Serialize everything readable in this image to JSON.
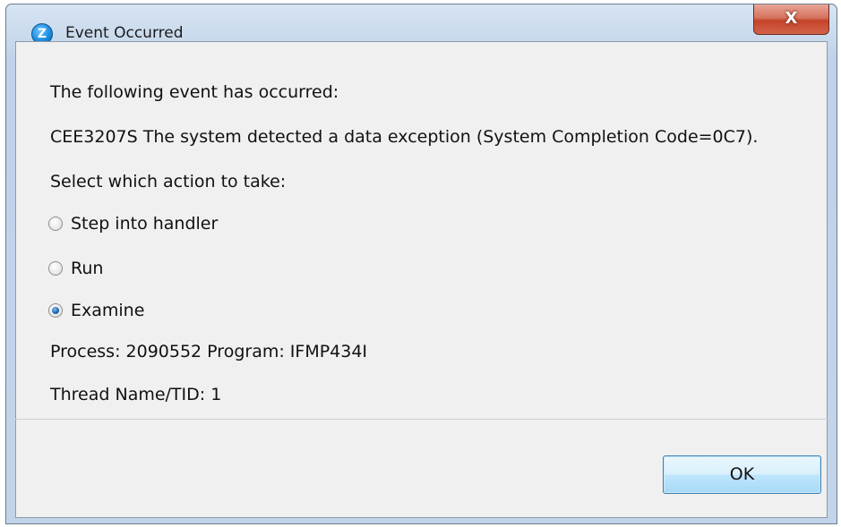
{
  "window": {
    "title": "Event Occurred",
    "close_label": "X"
  },
  "dialog": {
    "intro": "The following event has occurred:",
    "message": "CEE3207S The system detected a data exception (System Completion Code=0C7).",
    "prompt": "Select which action to take:",
    "options": [
      {
        "label": "Step into handler",
        "checked": false
      },
      {
        "label": "Run",
        "checked": false
      },
      {
        "label": "Examine",
        "checked": true
      }
    ],
    "process_line": "Process: 2090552  Program: IFMP434I",
    "thread_line": "Thread Name/TID: 1",
    "ok_label": "OK"
  },
  "icons": {
    "app_icon": "debugger-app-icon",
    "app_icon_glyph": "Z"
  },
  "colors": {
    "title_bar": "#c9d9ec",
    "client_bg": "#f0f0f0",
    "close_button": "#c5432a",
    "ok_button": "#bee6fd"
  }
}
